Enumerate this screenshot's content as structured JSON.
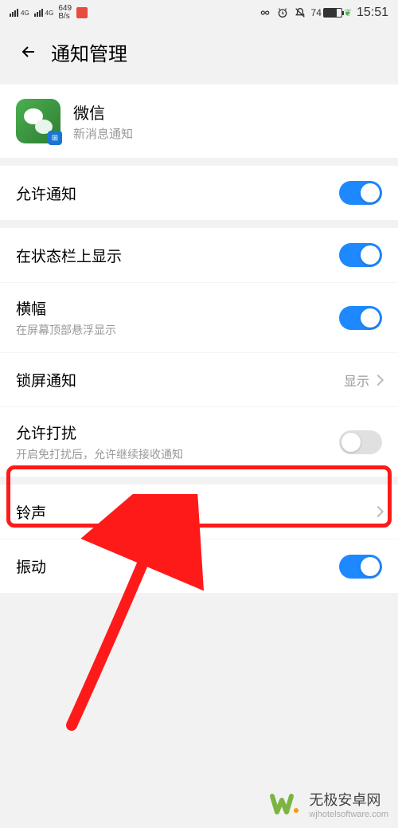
{
  "status": {
    "signal_label": "4G",
    "kbps_value": "649",
    "kbps_unit": "B/s",
    "battery_percent": "74",
    "time": "15:51"
  },
  "header": {
    "title": "通知管理"
  },
  "app": {
    "name": "微信",
    "subtitle": "新消息通知"
  },
  "rows": {
    "allow": {
      "label": "允许通知"
    },
    "statusbar": {
      "label": "在状态栏上显示"
    },
    "banner": {
      "label": "横幅",
      "sub": "在屏幕顶部悬浮显示"
    },
    "lockscreen": {
      "label": "锁屏通知",
      "value": "显示"
    },
    "dnd": {
      "label": "允许打扰",
      "sub": "开启免打扰后，允许继续接收通知"
    },
    "ringtone": {
      "label": "铃声"
    },
    "vibrate": {
      "label": "振动"
    }
  },
  "watermark": {
    "main": "无极安卓网",
    "sub": "wjhotelsoftware.com"
  }
}
